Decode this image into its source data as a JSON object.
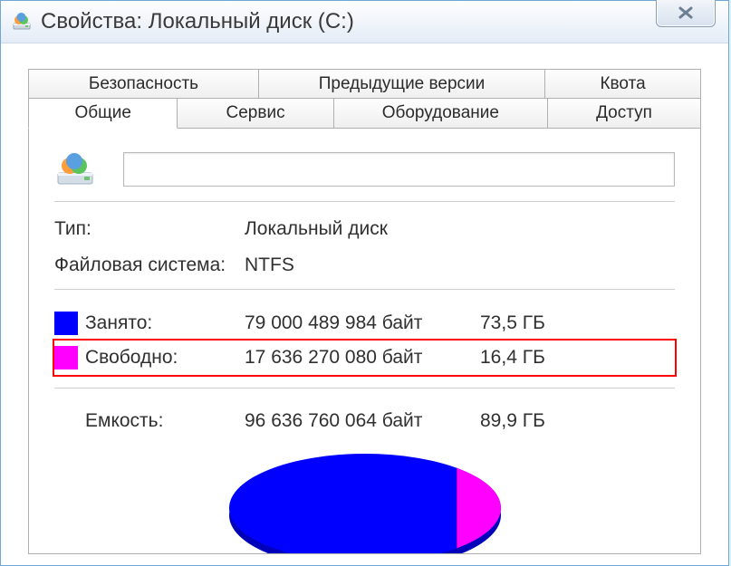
{
  "window": {
    "title": "Свойства: Локальный диск (C:)"
  },
  "tabs": {
    "row1": [
      "Безопасность",
      "Предыдущие версии",
      "Квота"
    ],
    "row2": [
      "Общие",
      "Сервис",
      "Оборудование",
      "Доступ"
    ],
    "active": "Общие"
  },
  "general": {
    "label_value": "",
    "type_label": "Тип:",
    "type_value": "Локальный диск",
    "fs_label": "Файловая система:",
    "fs_value": "NTFS",
    "used": {
      "label": "Занято:",
      "bytes": "79 000 489 984 байт",
      "human": "73,5 ГБ",
      "color": "#0000ff"
    },
    "free": {
      "label": "Свободно:",
      "bytes": "17 636 270 080 байт",
      "human": "16,4 ГБ",
      "color": "#ff00ff"
    },
    "capacity": {
      "label": "Емкость:",
      "bytes": "96 636 760 064 байт",
      "human": "89,9 ГБ"
    }
  },
  "chart_data": {
    "type": "pie",
    "title": "",
    "series": [
      {
        "name": "Занято",
        "value": 79000489984,
        "color": "#0000ff"
      },
      {
        "name": "Свободно",
        "value": 17636270080,
        "color": "#ff00ff"
      }
    ]
  }
}
